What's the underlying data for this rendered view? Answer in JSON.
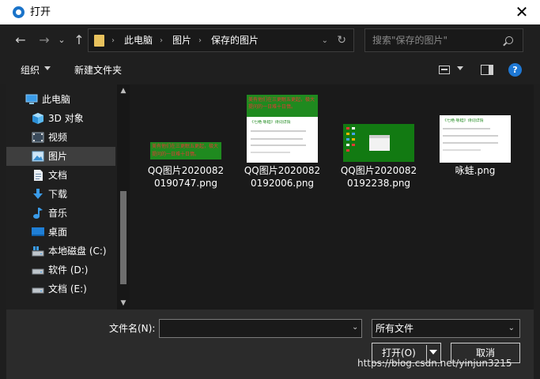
{
  "window": {
    "title": "打开",
    "close_glyph": "✕"
  },
  "nav": {
    "back_glyph": "←",
    "forward_glyph": "→",
    "recent_glyph": "⌄",
    "up_glyph": "↑"
  },
  "address": {
    "crumbs": [
      "此电脑",
      "图片",
      "保存的图片"
    ],
    "sep_glyph": "›",
    "dropdown_glyph": "⌄",
    "refresh_glyph": "↻"
  },
  "search": {
    "placeholder": "搜索\"保存的图片\""
  },
  "toolbar": {
    "organize_label": "组织",
    "new_folder_label": "新建文件夹",
    "help_glyph": "?"
  },
  "sidebar": {
    "items": [
      {
        "label": "此电脑",
        "icon": "computer-icon"
      },
      {
        "label": "3D 对象",
        "icon": "3d-objects-icon"
      },
      {
        "label": "视频",
        "icon": "video-icon"
      },
      {
        "label": "图片",
        "icon": "pictures-icon",
        "selected": true
      },
      {
        "label": "文档",
        "icon": "document-icon"
      },
      {
        "label": "下载",
        "icon": "download-icon"
      },
      {
        "label": "音乐",
        "icon": "music-icon"
      },
      {
        "label": "桌面",
        "icon": "desktop-icon"
      },
      {
        "label": "本地磁盘 (C:)",
        "icon": "drive-c-icon"
      },
      {
        "label": "软件 (D:)",
        "icon": "drive-d-icon"
      },
      {
        "label": "文档 (E:)",
        "icon": "drive-e-icon"
      }
    ],
    "scroll_up_glyph": "▲",
    "scroll_down_glyph": "▼"
  },
  "files": [
    {
      "name": "QQ图片20200820190747.png",
      "thumb_text": "美有他们在三更眠五更起，极大提问的一日难十日惰。"
    },
    {
      "name": "QQ图片20200820192006.png",
      "thumb_text": "美有他们在三更眠五更起，极大提问的一日难十日惰。",
      "thumb_heading": "《七绝·咏蛙》诗词详情"
    },
    {
      "name": "QQ图片20200820192238.png"
    },
    {
      "name": "咏蛙.png",
      "thumb_heading": "《七绝·咏蛙》诗词详情"
    }
  ],
  "footer": {
    "filename_label": "文件名(N):",
    "filename_value": "",
    "filetype_value": "所有文件",
    "open_label": "打开(O)",
    "cancel_label": "取消"
  },
  "watermark": "https://blog.csdn.net/yinjun3215"
}
